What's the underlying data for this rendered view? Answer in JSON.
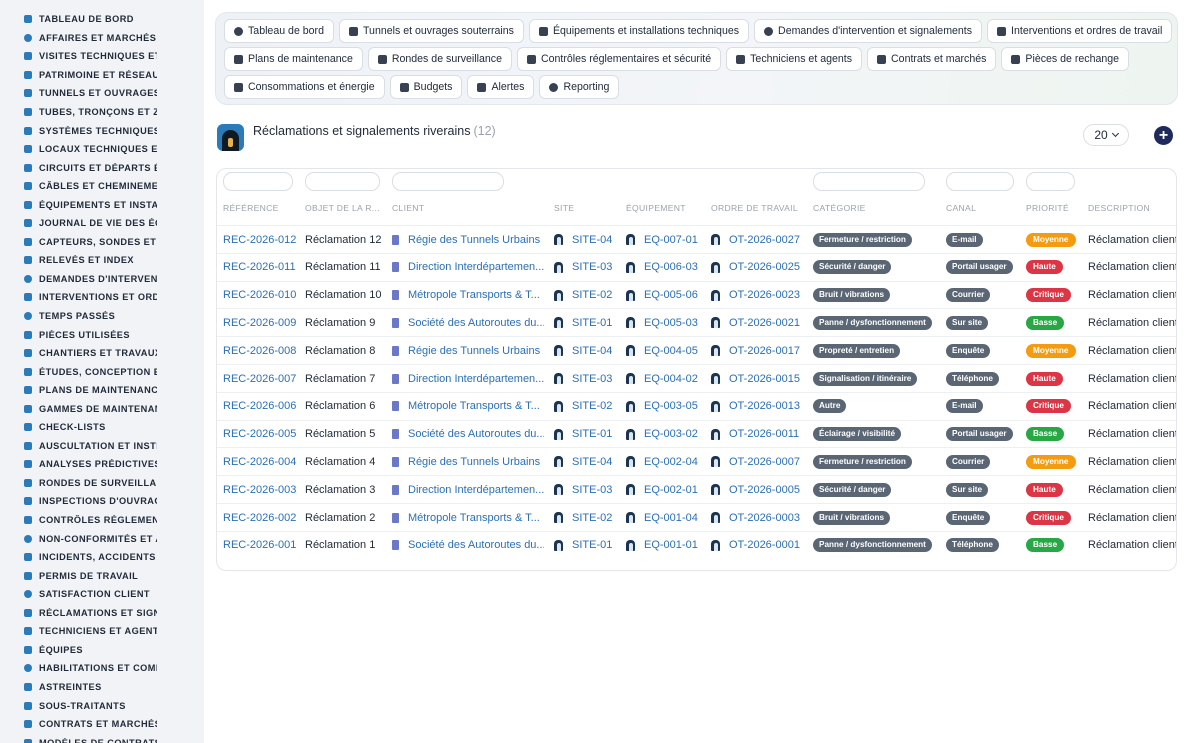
{
  "sidebar": {
    "items": [
      {
        "label": "TABLEAU DE BORD",
        "icon": "dashboard-icon"
      },
      {
        "label": "AFFAIRES ET MARCHÉS",
        "icon": "target-icon"
      },
      {
        "label": "VISITES TECHNIQUES ET",
        "icon": "walk-icon"
      },
      {
        "label": "PATRIMOINE ET RÉSEAUX",
        "icon": "map-pin-icon"
      },
      {
        "label": "TUNNELS ET OUVRAGES",
        "icon": "tunnel-icon"
      },
      {
        "label": "TUBES, TRONÇONS ET ZO",
        "icon": "segments-icon"
      },
      {
        "label": "SYSTÈMES TECHNIQUES",
        "icon": "sitemap-icon"
      },
      {
        "label": "LOCAUX TECHNIQUES ET",
        "icon": "grid-icon"
      },
      {
        "label": "CIRCUITS ET DÉPARTS É",
        "icon": "plug-icon"
      },
      {
        "label": "CÂBLES ET CHEMINEMEN",
        "icon": "lines-icon"
      },
      {
        "label": "ÉQUIPEMENTS ET INSTAL",
        "icon": "gears-icon"
      },
      {
        "label": "JOURNAL DE VIE DES ÉQ",
        "icon": "history-icon"
      },
      {
        "label": "CAPTEURS, SONDES ET C",
        "icon": "gauge-icon"
      },
      {
        "label": "RELEVÉS ET INDEX",
        "icon": "clipboard-icon"
      },
      {
        "label": "DEMANDES D'INTERVENT",
        "icon": "question-icon"
      },
      {
        "label": "INTERVENTIONS ET ORDI",
        "icon": "checklist-icon"
      },
      {
        "label": "TEMPS PASSÉS",
        "icon": "clock-icon"
      },
      {
        "label": "PIÈCES UTILISÉES",
        "icon": "puzzle-icon"
      },
      {
        "label": "CHANTIERS ET TRAVAUX",
        "icon": "hammer-icon"
      },
      {
        "label": "ÉTUDES, CONCEPTION ET",
        "icon": "pencil-ruler-icon"
      },
      {
        "label": "PLANS DE MAINTENANCE",
        "icon": "calendar-icon"
      },
      {
        "label": "GAMMES DE MAINTENAN",
        "icon": "list-icon"
      },
      {
        "label": "CHECK-LISTS",
        "icon": "checklist-icon"
      },
      {
        "label": "AUSCULTATION ET INSTR",
        "icon": "stethoscope-icon"
      },
      {
        "label": "ANALYSES PRÉDICTIVES",
        "icon": "chart-line-icon"
      },
      {
        "label": "RONDES DE SURVEILLAN",
        "icon": "route-icon"
      },
      {
        "label": "INSPECTIONS D'OUVRAG",
        "icon": "search-icon"
      },
      {
        "label": "CONTRÔLES RÉGLEMENT",
        "icon": "clipboard-check-icon"
      },
      {
        "label": "NON-CONFORMITÉS ET A",
        "icon": "alert-circle-icon"
      },
      {
        "label": "INCIDENTS, ACCIDENTS E",
        "icon": "warning-icon"
      },
      {
        "label": "PERMIS DE TRAVAIL",
        "icon": "file-signature-icon"
      },
      {
        "label": "SATISFACTION CLIENT",
        "icon": "smile-icon"
      },
      {
        "label": "RÉCLAMATIONS ET SIGN",
        "icon": "comment-icon"
      },
      {
        "label": "TECHNICIENS ET AGENTS",
        "icon": "hard-hat-icon"
      },
      {
        "label": "ÉQUIPES",
        "icon": "users-icon"
      },
      {
        "label": "HABILITATIONS ET COMP",
        "icon": "certificate-icon"
      },
      {
        "label": "ASTREINTES",
        "icon": "phone-icon"
      },
      {
        "label": "SOUS-TRAITANTS",
        "icon": "handshake-icon"
      },
      {
        "label": "CONTRATS ET MARCHÉS",
        "icon": "file-contract-icon"
      },
      {
        "label": "MODÈLES DE CONTRATS",
        "icon": "file-icon"
      }
    ]
  },
  "nav": {
    "rows": [
      [
        {
          "label": "Tableau de bord",
          "icon": "dashboard-icon"
        },
        {
          "label": "Tunnels et ouvrages souterrains",
          "icon": "building-icon"
        },
        {
          "label": "Équipements et installations techniques",
          "icon": "gears-icon"
        },
        {
          "label": "Demandes d'intervention et signalements",
          "icon": "question-icon"
        },
        {
          "label": "Interventions et ordres de travail",
          "icon": "clipboard-icon"
        }
      ],
      [
        {
          "label": "Plans de maintenance",
          "icon": "calendar-icon"
        },
        {
          "label": "Rondes de surveillance",
          "icon": "route-icon"
        },
        {
          "label": "Contrôles réglementaires et sécurité",
          "icon": "clipboard-check-icon"
        },
        {
          "label": "Techniciens et agents",
          "icon": "hard-hat-icon"
        },
        {
          "label": "Contrats et marchés",
          "icon": "file-contract-icon"
        },
        {
          "label": "Pièces de rechange",
          "icon": "sitemap-icon"
        }
      ],
      [
        {
          "label": "Consommations et énergie",
          "icon": "bolt-icon"
        },
        {
          "label": "Budgets",
          "icon": "money-icon"
        },
        {
          "label": "Alertes",
          "icon": "bell-icon"
        },
        {
          "label": "Reporting",
          "icon": "pie-chart-icon"
        }
      ]
    ]
  },
  "header": {
    "title": "Réclamations et signalements riverains",
    "count": "(12)",
    "per_page": "20",
    "add_icon": "plus-circle-icon"
  },
  "table": {
    "columns": [
      "RÉFÉRENCE",
      "OBJET DE LA R...",
      "CLIENT",
      "SITE",
      "ÉQUIPEMENT",
      "ORDRE DE TRAVAIL",
      "CATÉGORIE",
      "CANAL",
      "PRIORITÉ",
      "DESCRIPTION"
    ],
    "priority_colors": {
      "Moyenne": "#f39c12",
      "Haute": "#dc3545",
      "Critique": "#dc3545",
      "Basse": "#28a745"
    },
    "rows": [
      {
        "ref": "REC-2026-012",
        "objet": "Réclamation 12",
        "client": "Régie des Tunnels Urbains",
        "site": "SITE-04",
        "equipement": "EQ-007-01",
        "ordre": "OT-2026-0027",
        "categorie": "Fermeture / restriction",
        "canal": "E-mail",
        "priorite": "Moyenne",
        "description": "Réclamation client"
      },
      {
        "ref": "REC-2026-011",
        "objet": "Réclamation 11",
        "client": "Direction Interdépartemen...",
        "site": "SITE-03",
        "equipement": "EQ-006-03",
        "ordre": "OT-2026-0025",
        "categorie": "Sécurité / danger",
        "canal": "Portail usager",
        "priorite": "Haute",
        "description": "Réclamation client"
      },
      {
        "ref": "REC-2026-010",
        "objet": "Réclamation 10",
        "client": "Métropole Transports & T...",
        "site": "SITE-02",
        "equipement": "EQ-005-06",
        "ordre": "OT-2026-0023",
        "categorie": "Bruit / vibrations",
        "canal": "Courrier",
        "priorite": "Critique",
        "description": "Réclamation client"
      },
      {
        "ref": "REC-2026-009",
        "objet": "Réclamation 9",
        "client": "Société des Autoroutes du...",
        "site": "SITE-01",
        "equipement": "EQ-005-03",
        "ordre": "OT-2026-0021",
        "categorie": "Panne / dysfonctionnement",
        "canal": "Sur site",
        "priorite": "Basse",
        "description": "Réclamation client"
      },
      {
        "ref": "REC-2026-008",
        "objet": "Réclamation 8",
        "client": "Régie des Tunnels Urbains",
        "site": "SITE-04",
        "equipement": "EQ-004-05",
        "ordre": "OT-2026-0017",
        "categorie": "Propreté / entretien",
        "canal": "Enquête",
        "priorite": "Moyenne",
        "description": "Réclamation client"
      },
      {
        "ref": "REC-2026-007",
        "objet": "Réclamation 7",
        "client": "Direction Interdépartemen...",
        "site": "SITE-03",
        "equipement": "EQ-004-02",
        "ordre": "OT-2026-0015",
        "categorie": "Signalisation / itinéraire",
        "canal": "Téléphone",
        "priorite": "Haute",
        "description": "Réclamation client"
      },
      {
        "ref": "REC-2026-006",
        "objet": "Réclamation 6",
        "client": "Métropole Transports & T...",
        "site": "SITE-02",
        "equipement": "EQ-003-05",
        "ordre": "OT-2026-0013",
        "categorie": "Autre",
        "canal": "E-mail",
        "priorite": "Critique",
        "description": "Réclamation client"
      },
      {
        "ref": "REC-2026-005",
        "objet": "Réclamation 5",
        "client": "Société des Autoroutes du...",
        "site": "SITE-01",
        "equipement": "EQ-003-02",
        "ordre": "OT-2026-0011",
        "categorie": "Éclairage / visibilité",
        "canal": "Portail usager",
        "priorite": "Basse",
        "description": "Réclamation client"
      },
      {
        "ref": "REC-2026-004",
        "objet": "Réclamation 4",
        "client": "Régie des Tunnels Urbains",
        "site": "SITE-04",
        "equipement": "EQ-002-04",
        "ordre": "OT-2026-0007",
        "categorie": "Fermeture / restriction",
        "canal": "Courrier",
        "priorite": "Moyenne",
        "description": "Réclamation client"
      },
      {
        "ref": "REC-2026-003",
        "objet": "Réclamation 3",
        "client": "Direction Interdépartemen...",
        "site": "SITE-03",
        "equipement": "EQ-002-01",
        "ordre": "OT-2026-0005",
        "categorie": "Sécurité / danger",
        "canal": "Sur site",
        "priorite": "Haute",
        "description": "Réclamation client"
      },
      {
        "ref": "REC-2026-002",
        "objet": "Réclamation 2",
        "client": "Métropole Transports & T...",
        "site": "SITE-02",
        "equipement": "EQ-001-04",
        "ordre": "OT-2026-0003",
        "categorie": "Bruit / vibrations",
        "canal": "Enquête",
        "priorite": "Critique",
        "description": "Réclamation client"
      },
      {
        "ref": "REC-2026-001",
        "objet": "Réclamation 1",
        "client": "Société des Autoroutes du...",
        "site": "SITE-01",
        "equipement": "EQ-001-01",
        "ordre": "OT-2026-0001",
        "categorie": "Panne / dysfonctionnement",
        "canal": "Téléphone",
        "priorite": "Basse",
        "description": "Réclamation client"
      }
    ]
  }
}
